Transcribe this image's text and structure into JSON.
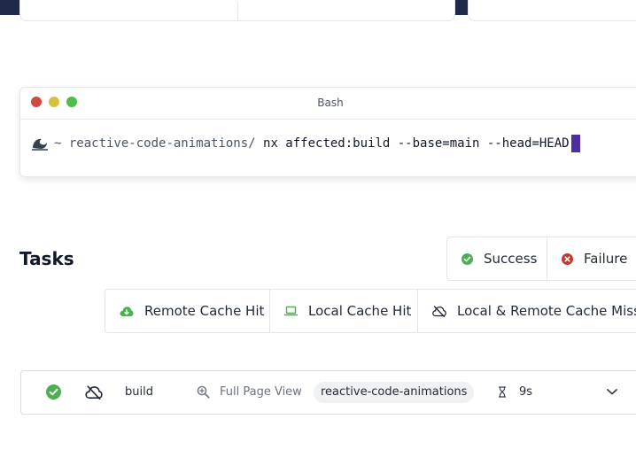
{
  "terminal": {
    "title": "Bash",
    "prompt": "~ reactive-code-animations/",
    "command": "nx affected:build --base=main --head=HEAD"
  },
  "tasks": {
    "title": "Tasks",
    "legend_status": [
      {
        "label": "Success",
        "icon": "check-circle-icon",
        "color": "#4caf50"
      },
      {
        "label": "Failure",
        "icon": "x-circle-icon",
        "color": "#c0392b"
      }
    ],
    "legend_cache": [
      {
        "label": "Remote Cache Hit",
        "icon": "cloud-download-icon",
        "color": "#4caf50"
      },
      {
        "label": "Local Cache Hit",
        "icon": "laptop-icon",
        "color": "#4caf50"
      },
      {
        "label": "Local & Remote Cache Miss",
        "icon": "cloud-off-icon",
        "color": "#1f2937"
      }
    ],
    "rows": [
      {
        "status_icon": "check-circle-icon",
        "cache_icon": "cloud-off-icon",
        "name": "build",
        "link_label": "Full Page View",
        "project": "reactive-code-animations",
        "duration": "9s"
      }
    ]
  }
}
